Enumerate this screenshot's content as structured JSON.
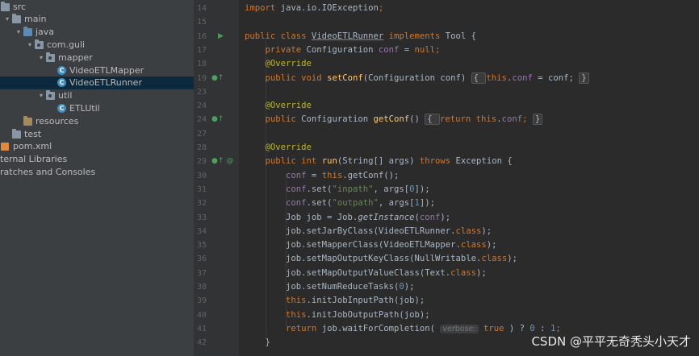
{
  "project_tree": {
    "items": [
      {
        "label": "src",
        "icon": "src-folder-icon",
        "arrow": "▾",
        "level": 0
      },
      {
        "label": "main",
        "icon": "folder-icon",
        "arrow": "▾",
        "level": 1
      },
      {
        "label": "java",
        "icon": "source-folder-icon",
        "arrow": "▾",
        "level": 2
      },
      {
        "label": "com.guli",
        "icon": "package-icon",
        "arrow": "▾",
        "level": 3
      },
      {
        "label": "mapper",
        "icon": "package-icon",
        "arrow": "▾",
        "level": 4
      },
      {
        "label": "VideoETLMapper",
        "icon": "class-icon",
        "arrow": "",
        "level": 5
      },
      {
        "label": "VideoETLRunner",
        "icon": "class-icon",
        "arrow": "",
        "level": 5,
        "selected": true
      },
      {
        "label": "util",
        "icon": "package-icon",
        "arrow": "▾",
        "level": 4
      },
      {
        "label": "ETLUtil",
        "icon": "class-icon",
        "arrow": "",
        "level": 5
      },
      {
        "label": "resources",
        "icon": "resources-folder-icon",
        "arrow": "",
        "level": 2
      },
      {
        "label": "test",
        "icon": "folder-icon",
        "arrow": "",
        "level": 1
      },
      {
        "label": "pom.xml",
        "icon": "xml-file-icon",
        "arrow": "",
        "level": 0
      },
      {
        "label": "ternal Libraries",
        "icon": "",
        "arrow": "",
        "level": -1
      },
      {
        "label": "ratches and Consoles",
        "icon": "",
        "arrow": "",
        "level": -1
      }
    ]
  },
  "editor": {
    "lines": [
      {
        "num": "14",
        "tokens": [
          [
            "kw",
            "import "
          ],
          [
            "",
            "java.io.IOException"
          ],
          [
            "kw",
            ";"
          ]
        ]
      },
      {
        "num": "15",
        "tokens": []
      },
      {
        "num": "16",
        "tokens": [
          [
            "kw",
            "public class "
          ],
          [
            "ul",
            "VideoETLRunner"
          ],
          [
            "kw",
            " implements "
          ],
          [
            "",
            "Tool {"
          ]
        ]
      },
      {
        "num": "17",
        "tokens": [
          [
            "",
            "    "
          ],
          [
            "kw",
            "private "
          ],
          [
            "",
            "Configuration "
          ],
          [
            "fd",
            "conf"
          ],
          [
            "",
            " = "
          ],
          [
            "kw",
            "null;"
          ]
        ]
      },
      {
        "num": "18",
        "tokens": [
          [
            "",
            "    "
          ],
          [
            "an",
            "@Override"
          ]
        ]
      },
      {
        "num": "19",
        "tokens": [
          [
            "",
            "    "
          ],
          [
            "kw",
            "public void "
          ],
          [
            "fn",
            "setConf"
          ],
          [
            "",
            "(Configuration conf) "
          ],
          [
            "fold",
            "{ "
          ],
          [
            "kw",
            "this"
          ],
          [
            "",
            "."
          ],
          [
            "fd",
            "conf"
          ],
          [
            "",
            " = conf; "
          ],
          [
            "fold",
            "}"
          ]
        ]
      },
      {
        "num": "23",
        "tokens": []
      },
      {
        "num": "24",
        "tokens": [
          [
            "",
            "    "
          ],
          [
            "an",
            "@Override"
          ]
        ]
      },
      {
        "num": "24",
        "tokens": [
          [
            "",
            "    "
          ],
          [
            "kw",
            "public "
          ],
          [
            "",
            "Configuration "
          ],
          [
            "fn",
            "getConf"
          ],
          [
            "",
            "() "
          ],
          [
            "fold",
            "{ "
          ],
          [
            "kw",
            "return this"
          ],
          [
            "",
            "."
          ],
          [
            "fd",
            "conf"
          ],
          [
            "kw",
            ";"
          ],
          [
            "",
            " "
          ],
          [
            "fold",
            "}"
          ]
        ]
      },
      {
        "num": "27",
        "tokens": []
      },
      {
        "num": "28",
        "tokens": [
          [
            "",
            "    "
          ],
          [
            "an",
            "@Override"
          ]
        ]
      },
      {
        "num": "29",
        "tokens": [
          [
            "",
            "    "
          ],
          [
            "kw",
            "public int "
          ],
          [
            "fn",
            "run"
          ],
          [
            "",
            "(String[] args) "
          ],
          [
            "kw",
            "throws "
          ],
          [
            "",
            "Exception {"
          ]
        ]
      },
      {
        "num": "30",
        "tokens": [
          [
            "",
            "        "
          ],
          [
            "fd",
            "conf"
          ],
          [
            "",
            " = "
          ],
          [
            "kw",
            "this"
          ],
          [
            "",
            ".getConf();"
          ]
        ]
      },
      {
        "num": "31",
        "tokens": [
          [
            "",
            "        "
          ],
          [
            "fd",
            "conf"
          ],
          [
            "",
            ".set("
          ],
          [
            "st",
            "\"inpath\""
          ],
          [
            "",
            ", args["
          ],
          [
            "nm",
            "0"
          ],
          [
            "",
            "]);"
          ]
        ]
      },
      {
        "num": "32",
        "tokens": [
          [
            "",
            "        "
          ],
          [
            "fd",
            "conf"
          ],
          [
            "",
            ".set("
          ],
          [
            "st",
            "\"outpath\""
          ],
          [
            "",
            ", args["
          ],
          [
            "nm",
            "1"
          ],
          [
            "",
            "]);"
          ]
        ]
      },
      {
        "num": "33",
        "tokens": [
          [
            "",
            "        Job job = Job."
          ],
          [
            "it",
            "getInstance"
          ],
          [
            "",
            "("
          ],
          [
            "fd",
            "conf"
          ],
          [
            "",
            ");"
          ]
        ]
      },
      {
        "num": "34",
        "tokens": [
          [
            "",
            "        job.setJarByClass(VideoETLRunner."
          ],
          [
            "kw",
            "class"
          ],
          [
            "",
            ");"
          ]
        ]
      },
      {
        "num": "35",
        "tokens": [
          [
            "",
            "        job.setMapperClass(VideoETLMapper."
          ],
          [
            "kw",
            "class"
          ],
          [
            "",
            ");"
          ]
        ]
      },
      {
        "num": "36",
        "tokens": [
          [
            "",
            "        job.setMapOutputKeyClass(NullWritable."
          ],
          [
            "kw",
            "class"
          ],
          [
            "",
            ");"
          ]
        ]
      },
      {
        "num": "37",
        "tokens": [
          [
            "",
            "        job.setMapOutputValueClass(Text."
          ],
          [
            "kw",
            "class"
          ],
          [
            "",
            ");"
          ]
        ]
      },
      {
        "num": "38",
        "tokens": [
          [
            "",
            "        job.setNumReduceTasks("
          ],
          [
            "nm",
            "0"
          ],
          [
            "",
            ");"
          ]
        ]
      },
      {
        "num": "39",
        "tokens": [
          [
            "",
            "        "
          ],
          [
            "kw",
            "this"
          ],
          [
            "",
            ".initJobInputPath(job);"
          ]
        ]
      },
      {
        "num": "40",
        "tokens": [
          [
            "",
            "        "
          ],
          [
            "kw",
            "this"
          ],
          [
            "",
            ".initJobOutputPath(job);"
          ]
        ]
      },
      {
        "num": "41",
        "tokens": [
          [
            "",
            "        "
          ],
          [
            "kw",
            "return "
          ],
          [
            "",
            "job.waitForCompletion( "
          ],
          [
            "hint",
            "verbose:"
          ],
          [
            "",
            " "
          ],
          [
            "kw",
            "true"
          ],
          [
            "",
            " ) ? "
          ],
          [
            "nm",
            "0"
          ],
          [
            "",
            " : "
          ],
          [
            "nm",
            "1"
          ],
          [
            "kw",
            ";"
          ]
        ]
      },
      {
        "num": "42",
        "tokens": [
          [
            "",
            "    }"
          ]
        ]
      }
    ]
  },
  "gutter_icons": [
    {
      "line_index": 2,
      "icon": "run-icon",
      "glyph": "▶",
      "color": "#499c54"
    },
    {
      "line_index": 5,
      "icon": "override-method-icon",
      "glyph": "●↑",
      "color": "#49a35b"
    },
    {
      "line_index": 8,
      "icon": "override-method-icon",
      "glyph": "●↑",
      "color": "#49a35b"
    },
    {
      "line_index": 11,
      "icon": "override-method-icon",
      "glyph": "●↑ @",
      "color": "#49a35b"
    }
  ],
  "watermark": "CSDN @平平无奇秃头小天才",
  "colors": {
    "keyword": "#cc7832",
    "annotation": "#bbb529",
    "field": "#9876aa",
    "method": "#ffc66d",
    "string": "#6a8759",
    "number": "#6897bb",
    "selection": "#0d293e",
    "background": "#2b2b2b"
  }
}
